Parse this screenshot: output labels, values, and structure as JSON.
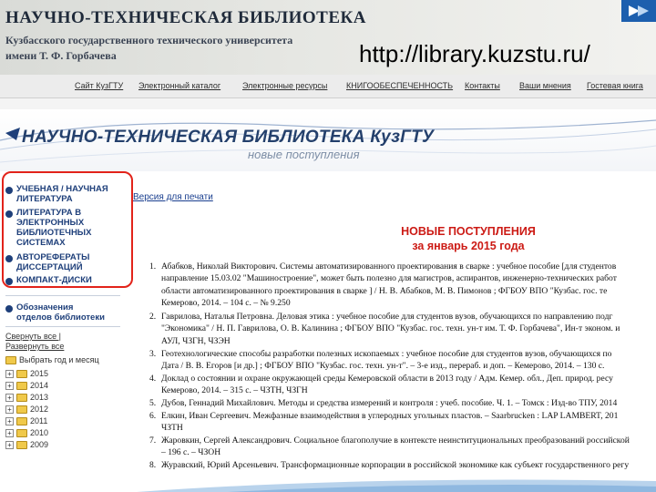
{
  "banner": {
    "title": "НАУЧНО-ТЕХНИЧЕСКАЯ БИБЛИОТЕКА",
    "subtitle_line1": "Кузбасского государственного технического университета",
    "subtitle_line2": "имени Т. Ф. Горбачева",
    "url": "http://library.kuzstu.ru/"
  },
  "topnav": {
    "items": [
      "Сайт КузГТУ",
      "Электронный каталог",
      "Электронные ресурсы",
      "КНИГООБЕСПЕЧЕННОСТЬ",
      "Контакты",
      "Ваши мнения",
      "Гостевая книга"
    ]
  },
  "library_header": {
    "title": "НАУЧНО-ТЕХНИЧЕСКАЯ БИБЛИОТЕКА КузГТУ",
    "subtitle": "новые поступления"
  },
  "sidebar": {
    "items": [
      {
        "lines": [
          "УЧЕБНАЯ / НАУЧНАЯ",
          "ЛИТЕРАТУРА"
        ]
      },
      {
        "lines": [
          "ЛИТЕРАТУРА В",
          "ЭЛЕКТРОННЫХ",
          "БИБЛИОТЕЧНЫХ",
          "СИСТЕМАХ"
        ]
      },
      {
        "lines": [
          "АВТОРЕФЕРАТЫ",
          "ДИССЕРТАЦИЙ"
        ]
      },
      {
        "lines": [
          "КОМПАКТ-ДИСКИ"
        ]
      }
    ],
    "extra": {
      "lines": [
        "Обозначения",
        "отделов библиотеки"
      ]
    },
    "collapse_all": "Свернуть все |",
    "expand_all": "Развернуть все",
    "choose": "Выбрать год и месяц",
    "years": [
      "2015",
      "2014",
      "2013",
      "2012",
      "2011",
      "2010",
      "2009"
    ]
  },
  "content": {
    "print_link": "Версия для печати",
    "heading_line1": "НОВЫЕ ПОСТУПЛЕНИЯ",
    "heading_line2": "за январь 2015 года",
    "records": [
      {
        "num": "1.",
        "lines": [
          "Абабков, Николай Викторович. Системы автоматизированного проектирования в сварке : учебное пособие [для студентов",
          "направление 15.03.02 \"Машиностроение\", может быть полезно для магистров, аспирантов, инженерно-технических работ",
          "области автоматизированного проектирования в сварке ] / Н. В. Абабков, М. В. Пимонов ; ФГБОУ ВПО \"Кузбас. гос. те",
          "Кемерово, 2014. – 104 с. – № 9.250"
        ]
      },
      {
        "num": "2.",
        "lines": [
          "Гаврилова, Наталья Петровна. Деловая этика : учебное пособие для студентов вузов, обучающихся по направлению подг",
          "\"Экономика\" / Н. П. Гаврилова, О. В. Калинина ; ФГБОУ ВПО \"Кузбас. гос. техн. ун-т им. Т. Ф. Горбачева\", Ин-т эконом. и",
          "АУЛ, ЧЗГН, ЧЗЭН"
        ]
      },
      {
        "num": "3.",
        "lines": [
          "Геотехнологические способы разработки полезных ископаемых : учебное пособие для студентов вузов, обучающихся по",
          "Дата / В. В. Егоров [и др.] ; ФГБОУ ВПО \"Кузбас. гос. техн. ун-т\". – 3-е изд., перераб. и доп. – Кемерово, 2014. – 130 с."
        ]
      },
      {
        "num": "4.",
        "lines": [
          "Доклад о состоянии и охране окружающей среды Кемеровской области в 2013 году / Адм. Кемер. обл., Деп. природ. ресу",
          "Кемерово, 2014. – 315 с. – ЧЗТН, ЧЗГН"
        ]
      },
      {
        "num": "5.",
        "lines": [
          "Дубов, Геннадий Михайлович. Методы и средства измерений и контроля : учеб. пособие. Ч. 1. – Томск : Изд-во ТПУ, 2014"
        ]
      },
      {
        "num": "6.",
        "lines": [
          "Елкин, Иван Сергеевич. Межфазные взаимодействия в углеродных угольных пластов. – Saarbrucken : LAP LAMBERT, 201",
          "ЧЗТН"
        ]
      },
      {
        "num": "7.",
        "lines": [
          "Жаровкин, Сергей Александрович. Социальное благополучие в контексте неинституциональных преобразований российской",
          "– 196 с. – ЧЗОН"
        ]
      },
      {
        "num": "8.",
        "lines": [
          "Журавский, Юрий Арсеньевич. Трансформационные корпорации в российской экономике как субъект государственного регу"
        ]
      }
    ]
  },
  "colors": {
    "accent_red": "#e2231a",
    "heading_red": "#cc1a14",
    "nav_blue": "#1e3f7a"
  }
}
